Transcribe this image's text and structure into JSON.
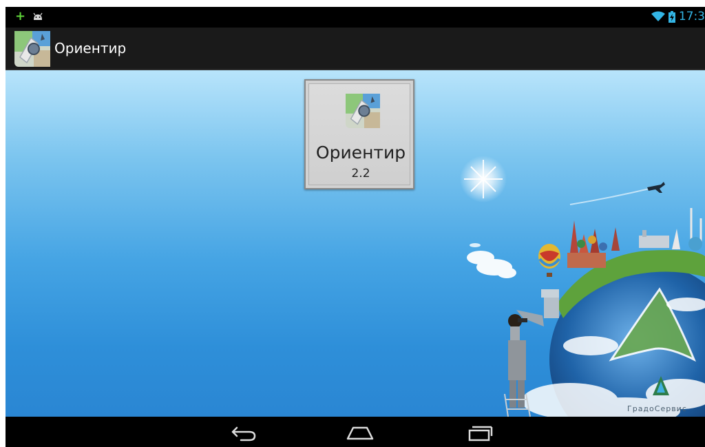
{
  "status_bar": {
    "time": "17:3",
    "icons": [
      "plus-icon",
      "android-debug-icon",
      "wifi-icon",
      "battery-charging-icon"
    ],
    "accent_color": "#33b5e5"
  },
  "action_bar": {
    "title": "Ориентир",
    "icon": "app-icon"
  },
  "about_card": {
    "app_name": "Ориентир",
    "version": "2.2",
    "icon": "app-icon"
  },
  "background": {
    "brand_text": "ГрадоСервис"
  },
  "nav_bar": {
    "buttons": [
      "back-icon",
      "home-icon",
      "recent-apps-icon"
    ]
  }
}
